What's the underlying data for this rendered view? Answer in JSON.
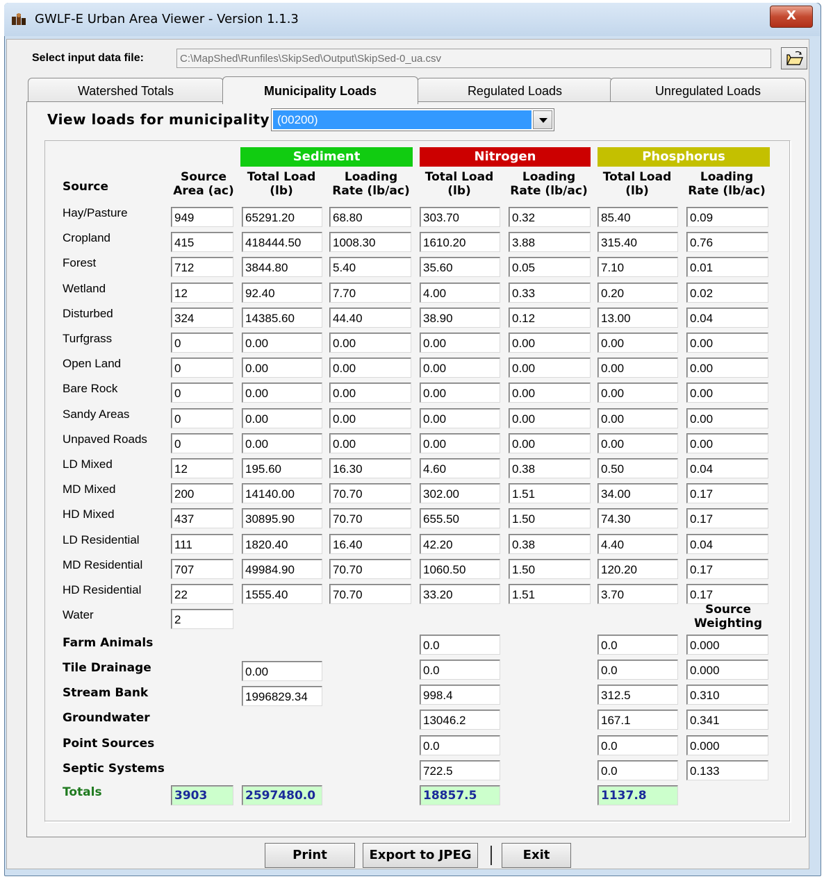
{
  "window": {
    "title": "GWLF-E Urban Area Viewer - Version 1.1.3",
    "close_glyph": "X"
  },
  "file": {
    "label": "Select input data file:",
    "path": "C:\\MapShed\\Runfiles\\SkipSed\\Output\\SkipSed-0_ua.csv"
  },
  "tabs": [
    {
      "label": "Watershed Totals",
      "active": false
    },
    {
      "label": "Municipality Loads",
      "active": true
    },
    {
      "label": "Regulated Loads",
      "active": false
    },
    {
      "label": "Unregulated Loads",
      "active": false
    }
  ],
  "municipality": {
    "label": "View loads for municipality:",
    "selected": "(00200)"
  },
  "groups": {
    "sediment": {
      "label": "Sediment",
      "color": "#11cc11"
    },
    "nitrogen": {
      "label": "Nitrogen",
      "color": "#cc0000"
    },
    "phosphorus": {
      "label": "Phosphorus",
      "color": "#c4c000"
    }
  },
  "headers": {
    "source": "Source",
    "source_area": "Source Area (ac)",
    "sed_total": "Total Load (lb)",
    "sed_rate": "Loading Rate (lb/ac)",
    "n_total": "Total Load (lb)",
    "n_rate": "Loading Rate (lb/ac)",
    "p_total": "Total Load (lb)",
    "p_rate": "Loading Rate (lb/ac)",
    "source_weighting": "Source Weighting"
  },
  "land_uses": [
    {
      "source": "Hay/Pasture",
      "area": "949",
      "sed_total": "65291.20",
      "sed_rate": "68.80",
      "n_total": "303.70",
      "n_rate": "0.32",
      "p_total": "85.40",
      "p_rate": "0.09"
    },
    {
      "source": "Cropland",
      "area": "415",
      "sed_total": "418444.50",
      "sed_rate": "1008.30",
      "n_total": "1610.20",
      "n_rate": "3.88",
      "p_total": "315.40",
      "p_rate": "0.76"
    },
    {
      "source": "Forest",
      "area": "712",
      "sed_total": "3844.80",
      "sed_rate": "5.40",
      "n_total": "35.60",
      "n_rate": "0.05",
      "p_total": "7.10",
      "p_rate": "0.01"
    },
    {
      "source": "Wetland",
      "area": "12",
      "sed_total": "92.40",
      "sed_rate": "7.70",
      "n_total": "4.00",
      "n_rate": "0.33",
      "p_total": "0.20",
      "p_rate": "0.02"
    },
    {
      "source": "Disturbed",
      "area": "324",
      "sed_total": "14385.60",
      "sed_rate": "44.40",
      "n_total": "38.90",
      "n_rate": "0.12",
      "p_total": "13.00",
      "p_rate": "0.04"
    },
    {
      "source": "Turfgrass",
      "area": "0",
      "sed_total": "0.00",
      "sed_rate": "0.00",
      "n_total": "0.00",
      "n_rate": "0.00",
      "p_total": "0.00",
      "p_rate": "0.00"
    },
    {
      "source": "Open Land",
      "area": "0",
      "sed_total": "0.00",
      "sed_rate": "0.00",
      "n_total": "0.00",
      "n_rate": "0.00",
      "p_total": "0.00",
      "p_rate": "0.00"
    },
    {
      "source": "Bare Rock",
      "area": "0",
      "sed_total": "0.00",
      "sed_rate": "0.00",
      "n_total": "0.00",
      "n_rate": "0.00",
      "p_total": "0.00",
      "p_rate": "0.00"
    },
    {
      "source": "Sandy Areas",
      "area": "0",
      "sed_total": "0.00",
      "sed_rate": "0.00",
      "n_total": "0.00",
      "n_rate": "0.00",
      "p_total": "0.00",
      "p_rate": "0.00"
    },
    {
      "source": "Unpaved Roads",
      "area": "0",
      "sed_total": "0.00",
      "sed_rate": "0.00",
      "n_total": "0.00",
      "n_rate": "0.00",
      "p_total": "0.00",
      "p_rate": "0.00"
    },
    {
      "source": "LD Mixed",
      "area": "12",
      "sed_total": "195.60",
      "sed_rate": "16.30",
      "n_total": "4.60",
      "n_rate": "0.38",
      "p_total": "0.50",
      "p_rate": "0.04"
    },
    {
      "source": "MD Mixed",
      "area": "200",
      "sed_total": "14140.00",
      "sed_rate": "70.70",
      "n_total": "302.00",
      "n_rate": "1.51",
      "p_total": "34.00",
      "p_rate": "0.17"
    },
    {
      "source": "HD Mixed",
      "area": "437",
      "sed_total": "30895.90",
      "sed_rate": "70.70",
      "n_total": "655.50",
      "n_rate": "1.50",
      "p_total": "74.30",
      "p_rate": "0.17"
    },
    {
      "source": "LD Residential",
      "area": "111",
      "sed_total": "1820.40",
      "sed_rate": "16.40",
      "n_total": "42.20",
      "n_rate": "0.38",
      "p_total": "4.40",
      "p_rate": "0.04"
    },
    {
      "source": "MD Residential",
      "area": "707",
      "sed_total": "49984.90",
      "sed_rate": "70.70",
      "n_total": "1060.50",
      "n_rate": "1.50",
      "p_total": "120.20",
      "p_rate": "0.17"
    },
    {
      "source": "HD Residential",
      "area": "22",
      "sed_total": "1555.40",
      "sed_rate": "70.70",
      "n_total": "33.20",
      "n_rate": "1.51",
      "p_total": "3.70",
      "p_rate": "0.17"
    }
  ],
  "water": {
    "source": "Water",
    "area": "2"
  },
  "other_sources": [
    {
      "source": "Farm Animals",
      "sed_total": null,
      "n_total": "0.0",
      "p_total": "0.0",
      "weighting": "0.000"
    },
    {
      "source": "Tile Drainage",
      "sed_total": "0.00",
      "n_total": "0.0",
      "p_total": "0.0",
      "weighting": "0.000"
    },
    {
      "source": "Stream Bank",
      "sed_total": "1996829.34",
      "n_total": "998.4",
      "p_total": "312.5",
      "weighting": "0.310"
    },
    {
      "source": "Groundwater",
      "sed_total": null,
      "n_total": "13046.2",
      "p_total": "167.1",
      "weighting": "0.341"
    },
    {
      "source": "Point Sources",
      "sed_total": null,
      "n_total": "0.0",
      "p_total": "0.0",
      "weighting": "0.000"
    },
    {
      "source": "Septic Systems",
      "sed_total": null,
      "n_total": "722.5",
      "p_total": "0.0",
      "weighting": "0.133"
    }
  ],
  "totals": {
    "label": "Totals",
    "area": "3903",
    "sediment": "2597480.0",
    "nitrogen": "18857.5",
    "phosphorus": "1137.8"
  },
  "buttons": {
    "print": "Print",
    "export": "Export to JPEG",
    "exit": "Exit"
  }
}
